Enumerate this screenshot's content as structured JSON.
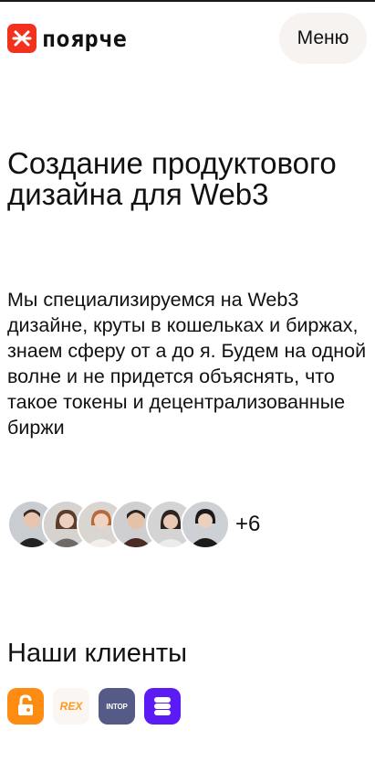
{
  "header": {
    "logo_text": "поярче",
    "menu_label": "Меню"
  },
  "hero": {
    "title": "Создание продуктового дизайна для Web3",
    "description": "Мы специализируемся на Web3 дизайне, круты в кошельках и биржах, знаем сферу от а до я. Будем на одной волне и не придется объяснять, что такое токены и децентрализованные биржи"
  },
  "team": {
    "more_count": "+6"
  },
  "clients": {
    "title": "Наши клиенты",
    "logos": [
      "lock-logo",
      "REX",
      "INTOP",
      "s-logo"
    ]
  },
  "colors": {
    "brand": "#f2311f",
    "menu_bg": "#f6f3f1",
    "client_lock": "#ff8c12",
    "client_rex_text": "#ff9a1b",
    "client_intop": "#565a87",
    "client_s": "#5a1bf5"
  }
}
